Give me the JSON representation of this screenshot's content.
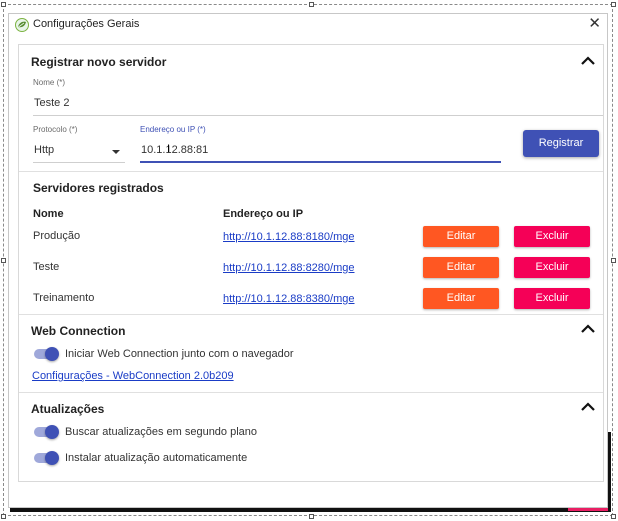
{
  "window": {
    "title": "Configurações Gerais",
    "close_glyph": "✕",
    "app_icon": "leaf-logo-icon"
  },
  "register": {
    "title": "Registrar novo servidor",
    "name_label": "Nome (*)",
    "name_value": "Teste 2",
    "protocol_label": "Protocolo (*)",
    "protocol_value": "Http",
    "address_label": "Endereço ou IP (*)",
    "address_value": "10.1.12.88:81",
    "register_button": "Registrar"
  },
  "servers": {
    "title": "Servidores registrados",
    "columns": [
      "Nome",
      "Endereço ou IP"
    ],
    "rows": [
      {
        "name": "Produção",
        "url": "http://10.1.12.88:8180/mge"
      },
      {
        "name": "Teste",
        "url": "http://10.1.12.88:8280/mge"
      },
      {
        "name": "Treinamento",
        "url": "http://10.1.12.88:8380/mge"
      }
    ],
    "edit_label": "Editar",
    "delete_label": "Excluir"
  },
  "web_connection": {
    "title": "Web Connection",
    "toggle_label": "Iniciar Web Connection junto com o navegador",
    "toggle_on": true,
    "settings_link": "Configurações - WebConnection 2.0b209"
  },
  "updates": {
    "title": "Atualizações",
    "toggles": [
      {
        "label": "Buscar atualizações em segundo plano",
        "on": true
      },
      {
        "label": "Instalar atualização automaticamente",
        "on": true
      }
    ]
  },
  "colors": {
    "primary": "#3f51b5",
    "edit": "#ff5722",
    "delete": "#f50057",
    "link": "#1a3cc6"
  }
}
